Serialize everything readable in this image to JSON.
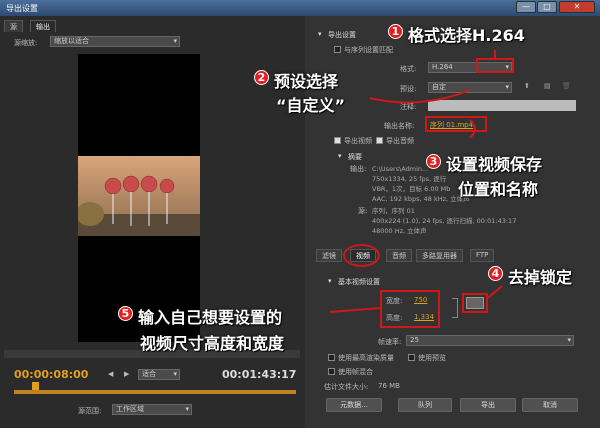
{
  "window": {
    "title": "导出设置",
    "min": "—",
    "max": "□",
    "close": "✕"
  },
  "left_tabs": {
    "source": "源",
    "output": "输出"
  },
  "source_scaling": {
    "label": "源缩放:",
    "value": "缩放以适合"
  },
  "timeline": {
    "current_time": "00:00:08:00",
    "fit": "适合",
    "duration": "00:01:43:17"
  },
  "range": {
    "label": "源范围:",
    "value": "工作区域"
  },
  "export": {
    "section_title": "导出设置",
    "match_sequence": "与序列设置匹配",
    "format_label": "格式:",
    "format_value": "H.264",
    "preset_label": "预设:",
    "preset_value": "自定",
    "comments_label": "注释:",
    "output_name_label": "输出名称:",
    "output_name_value": "序列 01.mp4",
    "export_video": "导出视频",
    "export_audio": "导出音频"
  },
  "summary": {
    "title": "摘要",
    "output_label": "输出:",
    "output_lines": [
      "C:\\Users\\Admin...",
      "750x1334, 25 fps, 逐行",
      "VBR，1次，目标 6.00 Mb",
      "AAC, 192 kbps, 48 kHz, 立体声"
    ],
    "source_label": "源:",
    "source_lines": [
      "序列，序列 01",
      "400x224 (1.0), 24 fps, 逐行扫描, 00:01:43:17",
      "48000 Hz, 立体声"
    ]
  },
  "sub_tabs": [
    "滤镜",
    "视频",
    "音频",
    "多路复用器",
    "FTP"
  ],
  "video_settings": {
    "title": "基本视频设置",
    "width_label": "宽度:",
    "width_value": "750",
    "height_label": "高度:",
    "height_value": "1,334",
    "framerate_label": "帧速率:",
    "framerate_value": "25"
  },
  "bottom_options": {
    "max_render": "使用最高渲染质量",
    "use_preview": "使用预览",
    "frame_blend": "使用帧混合",
    "file_size_label": "估计文件大小:",
    "file_size_value": "76 MB"
  },
  "buttons": {
    "metadata": "元数据...",
    "queue": "队列",
    "export": "导出",
    "cancel": "取消"
  },
  "annotations": {
    "a1_num": "1",
    "a1_text": "格式选择H.264",
    "a2_num": "2",
    "a2_line1": "预设选择",
    "a2_line2": "“自定义”",
    "a3_num": "3",
    "a3_line1": "设置视频保存",
    "a3_line2": "位置和名称",
    "a4_num": "4",
    "a4_text": "去掉锁定",
    "a5_num": "5",
    "a5_line1": "输入自己想要设置的",
    "a5_line2": "视频尺寸高度和宽度"
  },
  "colors": {
    "accent_red": "#d01818",
    "timecode": "#e0a020",
    "link": "#e0a020"
  }
}
